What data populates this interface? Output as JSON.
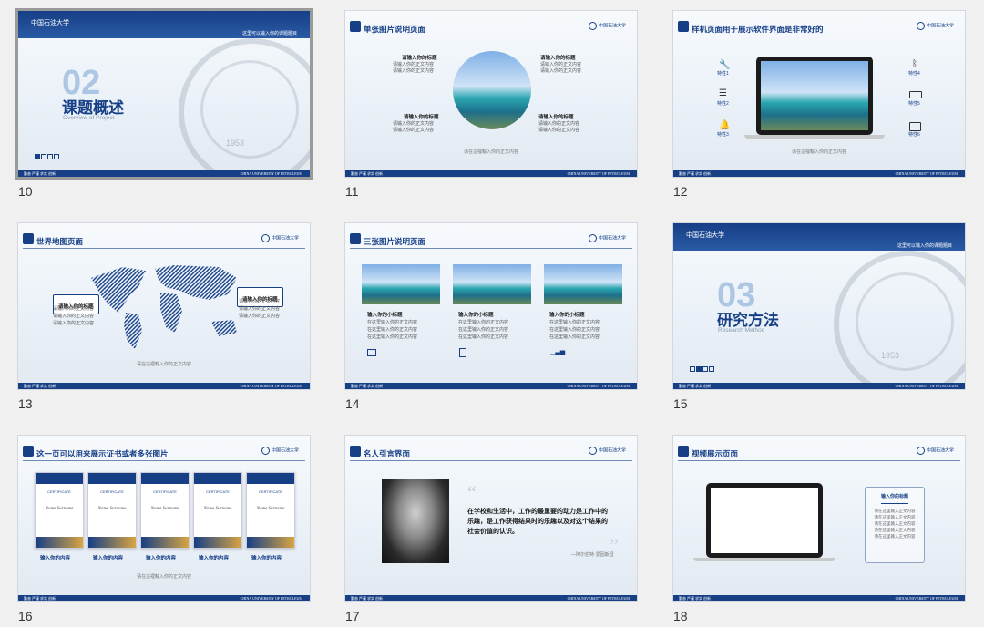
{
  "slides": [
    {
      "number": "10",
      "logo": "中国石油大学",
      "subtitle_bar": "这里可以输入你的课题题目",
      "section_num": "02",
      "title": "课题概述",
      "en_title": "Overview of Project",
      "footer_left": "勤奋 严谨 求实 创新",
      "footer_right": "CHINA UNIVERSITY OF PETROLEUM",
      "seal_year": "1953"
    },
    {
      "number": "11",
      "title": "单张图片说明页面",
      "block_title": "请输入你的标题",
      "line1": "请输入你的正文内容",
      "line2": "请输入你的正文内容",
      "caption": "请在這裡輸入你的正文内容",
      "footer_left": "勤奋 严谨 求实 创新",
      "footer_right": "CHINA UNIVERSITY OF PETROLEUM"
    },
    {
      "number": "12",
      "title": "样机页面用于展示软件界面是非常好的",
      "features": [
        "特性1",
        "特性2",
        "特性3",
        "特性4",
        "特性5",
        "特性6"
      ],
      "caption": "请在這裡輸入你的正文内容",
      "footer_left": "勤奋 严谨 求实 创新",
      "footer_right": "CHINA UNIVERSITY OF PETROLEUM"
    },
    {
      "number": "13",
      "title": "世界地图页面",
      "box_title": "请输入你的标题",
      "line": "请输入你的正文内容",
      "caption": "请在這裡輸入你的正文内容",
      "footer_left": "勤奋 严谨 求实 创新",
      "footer_right": "CHINA UNIVERSITY OF PETROLEUM"
    },
    {
      "number": "14",
      "title": "三张图片说明页面",
      "sub_title": "输入你的小标题",
      "line": "在这里输入你的正文内容",
      "footer_left": "勤奋 严谨 求实 创新",
      "footer_right": "CHINA UNIVERSITY OF PETROLEUM"
    },
    {
      "number": "15",
      "logo": "中国石油大学",
      "subtitle_bar": "这里可以输入你的课题题目",
      "section_num": "03",
      "title": "研究方法",
      "en_title": "Research Method",
      "footer_left": "勤奋 严谨 求实 创新",
      "footer_right": "CHINA UNIVERSITY OF PETROLEUM",
      "seal_year": "1953"
    },
    {
      "number": "16",
      "title": "这一页可以用来展示证书或者多张图片",
      "cert_label": "CERTIFICATE",
      "cert_name": "Name Surname",
      "input_label": "输入你的内容",
      "caption": "请在這裡輸入你的正文内容",
      "footer_left": "勤奋 严谨 求实 创新",
      "footer_right": "CHINA UNIVERSITY OF PETROLEUM"
    },
    {
      "number": "17",
      "title": "名人引言界面",
      "quote": "在学校和生活中，工作的最重要的动力是工作中的乐趣，是工作获得结果时的乐趣以及对这个结果的社会价值的认识。",
      "author": "—阿尔伯特·爱因斯坦",
      "footer_left": "勤奋 严谨 求实 创新",
      "footer_right": "CHINA UNIVERSITY OF PETROLEUM"
    },
    {
      "number": "18",
      "title": "视频展示页面",
      "box_title": "输入你的标题",
      "line": "请在这里输入正文内容",
      "footer_left": "勤奋 严谨 求实 创新",
      "footer_right": "CHINA UNIVERSITY OF PETROLEUM"
    }
  ],
  "colors": {
    "brand": "#163f86",
    "background": "#f0f0f0"
  }
}
